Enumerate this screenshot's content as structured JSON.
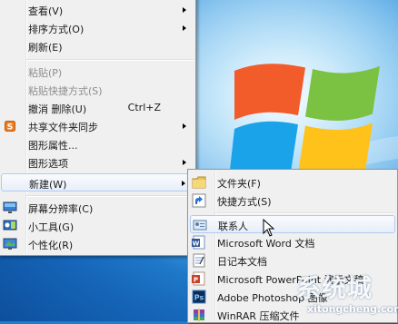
{
  "main_menu": {
    "items": [
      {
        "label": "查看(V)",
        "submenu": true
      },
      {
        "label": "排序方式(O)",
        "submenu": true
      },
      {
        "label": "刷新(E)"
      },
      {
        "label": "粘贴(P)",
        "disabled": true
      },
      {
        "label": "粘贴快捷方式(S)",
        "disabled": true
      },
      {
        "label": "撤消 删除(U)",
        "shortcut": "Ctrl+Z"
      },
      {
        "label": "共享文件夹同步",
        "submenu": true,
        "icon": "sync-icon"
      },
      {
        "label": "图形属性..."
      },
      {
        "label": "图形选项",
        "submenu": true
      },
      {
        "label": "新建(W)",
        "submenu": true
      },
      {
        "label": "屏幕分辨率(C)",
        "icon": "screen-resolution-icon"
      },
      {
        "label": "小工具(G)",
        "icon": "gadgets-icon"
      },
      {
        "label": "个性化(R)",
        "icon": "personalize-icon"
      }
    ]
  },
  "new_submenu": {
    "items": [
      {
        "label": "文件夹(F)",
        "icon": "folder-icon"
      },
      {
        "label": "快捷方式(S)",
        "icon": "shortcut-icon"
      },
      {
        "label": "联系人",
        "icon": "contact-icon"
      },
      {
        "label": "Microsoft Word 文档",
        "icon": "word-icon"
      },
      {
        "label": "日记本文档",
        "icon": "journal-icon"
      },
      {
        "label": "Microsoft PowerPoint 演示文稿",
        "icon": "powerpoint-icon"
      },
      {
        "label": "Adobe Photoshop 图像",
        "icon": "photoshop-icon"
      },
      {
        "label": "WinRAR 压缩文件",
        "icon": "winrar-icon"
      }
    ]
  },
  "watermark": {
    "logo": "系统城",
    "url": "xitongcheng.com"
  },
  "colors": {
    "menu_bg": "#f0f0f0",
    "highlight_border": "#aeccf1",
    "desktop_blue": "#1b7fd0"
  }
}
